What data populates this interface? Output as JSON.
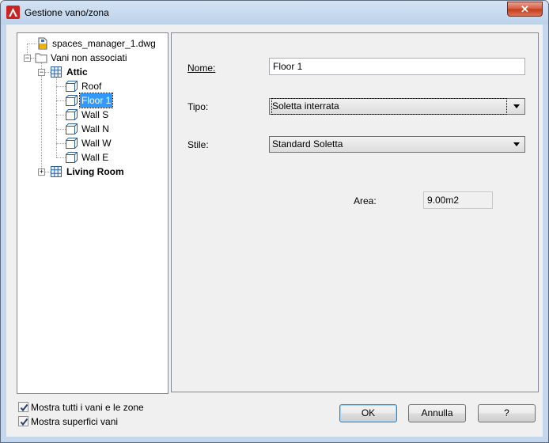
{
  "window": {
    "title": "Gestione vano/zona",
    "close_label": "✕"
  },
  "tree": {
    "root": "spaces_manager_1.dwg",
    "group": "Vani non associati",
    "attic": "Attic",
    "attic_children": [
      "Roof",
      "Floor 1",
      "Wall S",
      "Wall N",
      "Wall W",
      "Wall E"
    ],
    "living_room": "Living Room",
    "selected": "Floor 1"
  },
  "properties": {
    "nome_label": "Nome:",
    "nome_value": "Floor 1",
    "tipo_label": "Tipo:",
    "tipo_value": "Soletta interrata",
    "stile_label": "Stile:",
    "stile_value": "Standard Soletta",
    "area_label": "Area:",
    "area_value": "9.00m2"
  },
  "options": {
    "show_all_label": "Mostra tutti i vani e le zone",
    "show_all_checked": true,
    "show_surfaces_label": "Mostra superfici vani",
    "show_surfaces_checked": true
  },
  "buttons": {
    "ok": "OK",
    "cancel": "Annulla",
    "help": "?"
  },
  "colors": {
    "selection": "#3399ff",
    "app_icon": "#cc2222"
  }
}
